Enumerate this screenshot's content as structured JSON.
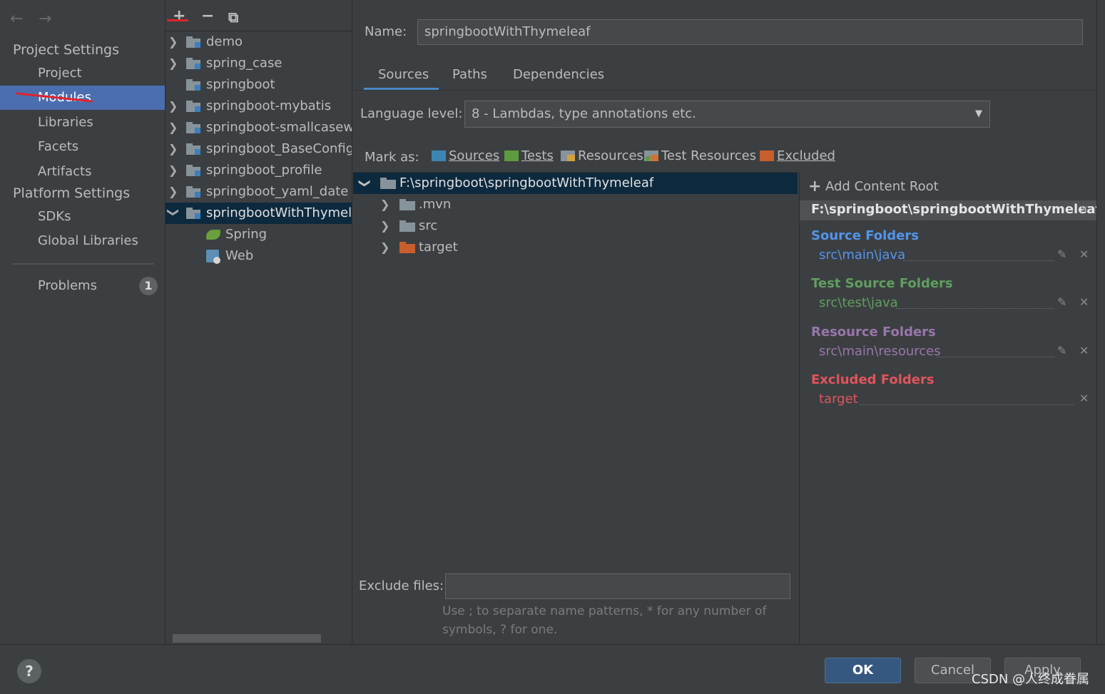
{
  "sidebar": {
    "back": "←",
    "forward": "→",
    "project_settings": "Project Settings",
    "platform_settings": "Platform Settings",
    "items": [
      {
        "label": "Project"
      },
      {
        "label": "Modules"
      },
      {
        "label": "Libraries"
      },
      {
        "label": "Facets"
      },
      {
        "label": "Artifacts"
      },
      {
        "label": "SDKs"
      },
      {
        "label": "Global Libraries"
      },
      {
        "label": "Problems",
        "badge": "1"
      }
    ]
  },
  "module_toolbar": {
    "add": "+",
    "remove": "−",
    "copy": "⧉"
  },
  "modules": [
    {
      "label": "demo"
    },
    {
      "label": "spring_case"
    },
    {
      "label": "springboot"
    },
    {
      "label": "springboot-mybatis"
    },
    {
      "label": "springboot-smallcasewi"
    },
    {
      "label": "springboot_BaseConfig"
    },
    {
      "label": "springboot_profile"
    },
    {
      "label": "springboot_yaml_date"
    },
    {
      "label": "springbootWithThymele"
    },
    {
      "label": "Spring"
    },
    {
      "label": "Web"
    }
  ],
  "content": {
    "name_label": "Name:",
    "name_value": "springbootWithThymeleaf",
    "tabs": [
      "Sources",
      "Paths",
      "Dependencies"
    ],
    "language_label": "Language level:",
    "language_value": "8 - Lambdas, type annotations etc.",
    "mark_as_label": "Mark as:",
    "mark_items": [
      "Sources",
      "Tests",
      "Resources",
      "Test Resources",
      "Excluded"
    ],
    "tree": [
      {
        "label": "F:\\springboot\\springbootWithThymeleaf"
      },
      {
        "label": ".mvn"
      },
      {
        "label": "src"
      },
      {
        "label": "target"
      }
    ],
    "exclude_label": "Exclude files:",
    "exclude_value": "",
    "exclude_hint_1": "Use ; to separate name patterns, * for any number of",
    "exclude_hint_2": "symbols, ? for one."
  },
  "roots": {
    "add_root": "Add Content Root",
    "root_path": "F:\\springboot\\springbootWithThymeleaf",
    "source_title": "Source Folders",
    "source_path": "src\\main\\java",
    "test_title": "Test Source Folders",
    "test_path": "src\\test\\java",
    "resource_title": "Resource Folders",
    "resource_path": "src\\main\\resources",
    "excluded_title": "Excluded Folders",
    "excluded_path": "target"
  },
  "buttons": {
    "help": "?",
    "ok": "OK",
    "cancel": "Cancel",
    "apply": "Apply"
  },
  "watermark": "CSDN @人终成眷属",
  "colors": {
    "source": "#5394ec",
    "test": "#5f9f5f",
    "resource": "#9876aa",
    "excluded": "#e0545c",
    "selection": "#4b6eaf"
  }
}
